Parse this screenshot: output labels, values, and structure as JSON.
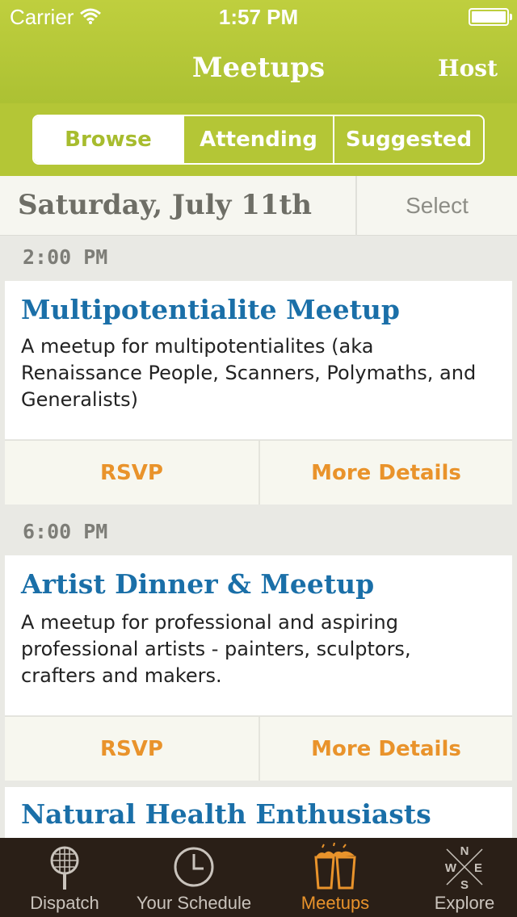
{
  "status": {
    "carrier": "Carrier",
    "time": "1:57 PM"
  },
  "nav": {
    "title": "Meetups",
    "right": "Host"
  },
  "segments": [
    "Browse",
    "Attending",
    "Suggested"
  ],
  "date": {
    "label": "Saturday, July 11th",
    "select": "Select"
  },
  "events": [
    {
      "time": "2:00 PM",
      "title": "Multipotentialite Meetup",
      "desc": "A meetup for multipotentialites (aka Renaissance People, Scanners, Polymaths, and Generalists)",
      "rsvp": "RSVP",
      "details": "More Details"
    },
    {
      "time": "6:00 PM",
      "title": "Artist Dinner & Meetup",
      "desc": "A meetup for professional and aspiring professional artists - painters, sculptors, crafters and makers.",
      "rsvp": "RSVP",
      "details": "More Details"
    },
    {
      "title": "Natural Health Enthusiasts"
    }
  ],
  "tabs": [
    {
      "label": "Dispatch",
      "icon": "racket-icon"
    },
    {
      "label": "Your Schedule",
      "icon": "clock-icon"
    },
    {
      "label": "Meetups",
      "icon": "beer-glasses-icon",
      "active": true
    },
    {
      "label": "Explore",
      "icon": "compass-icon"
    }
  ],
  "compass": {
    "n": "N",
    "w": "W",
    "e": "E",
    "s": "S"
  },
  "colors": {
    "green": "#b4c636",
    "blue": "#1a6fa8",
    "orange": "#e9932b",
    "tabbar": "#2a1f17"
  }
}
